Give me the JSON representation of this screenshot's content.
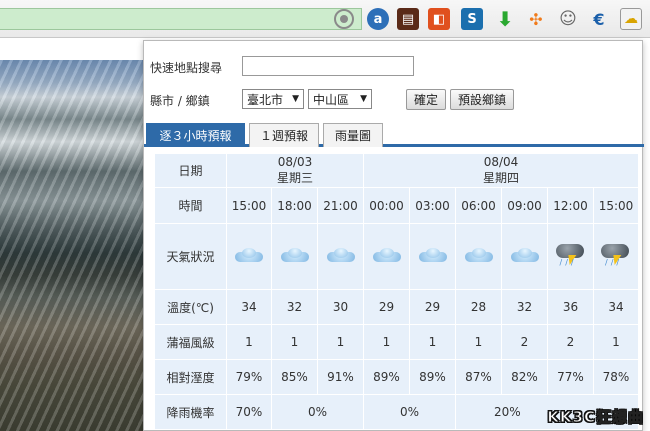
{
  "popup": {
    "search_label": "快速地點搜尋",
    "search_value": "",
    "region_label": "縣市 / 鄉鎮",
    "city_select": "臺北市",
    "district_select": "中山區",
    "confirm_button": "確定",
    "default_button": "預設鄉鎮"
  },
  "tabs": [
    {
      "label": "逐３小時預報"
    },
    {
      "label": "１週預報"
    },
    {
      "label": "雨量圖"
    }
  ],
  "forecast": {
    "row_labels": {
      "date": "日期",
      "time": "時間",
      "weather": "天氣狀況",
      "temp": "溫度(℃)",
      "wind": "蒲福風級",
      "humidity": "相對溼度",
      "rain": "降雨機率"
    },
    "dates": [
      {
        "date": "08/03",
        "weekday": "星期三"
      },
      {
        "date": "08/04",
        "weekday": "星期四"
      }
    ],
    "times": [
      "15:00",
      "18:00",
      "21:00",
      "00:00",
      "03:00",
      "06:00",
      "09:00",
      "12:00",
      "15:00"
    ],
    "weather_icons": [
      "cloud-icon",
      "cloud-icon",
      "cloud-icon",
      "cloud-icon",
      "cloud-icon",
      "cloud-icon",
      "cloud-icon",
      "thunderstorm-icon",
      "thunderstorm-icon"
    ],
    "temps": [
      "34",
      "32",
      "30",
      "29",
      "29",
      "28",
      "32",
      "36",
      "34"
    ],
    "wind": [
      "1",
      "1",
      "1",
      "1",
      "1",
      "1",
      "2",
      "2",
      "1"
    ],
    "humidity": [
      "79%",
      "85%",
      "91%",
      "89%",
      "89%",
      "87%",
      "82%",
      "77%",
      "78%"
    ],
    "rain": [
      "70%",
      "0%",
      "0%",
      "20%"
    ]
  },
  "watermark": "KK3C狂想曲",
  "colors": {
    "tab_active": "#2e6aa8",
    "table_bg": "#e7f0fa",
    "url_secure": "#cdeccd"
  }
}
